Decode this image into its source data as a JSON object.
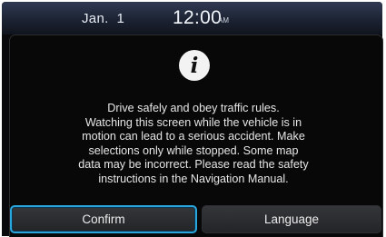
{
  "status_bar": {
    "date": "Jan.  1",
    "time": "12:00",
    "ampm": "AM"
  },
  "dialog": {
    "icon": "info-icon",
    "message": "Drive safely and obey traffic rules.\nWatching this screen while the vehicle is in\nmotion can lead to a serious accident. Make\nselections only while stopped. Some map\ndata may be incorrect. Please read the safety\ninstructions in the Navigation Manual.",
    "buttons": {
      "confirm": "Confirm",
      "language": "Language"
    }
  },
  "colors": {
    "focus_ring": "#2aa6dc",
    "dialog_background": "#080808",
    "status_bar": "#1c2333"
  }
}
